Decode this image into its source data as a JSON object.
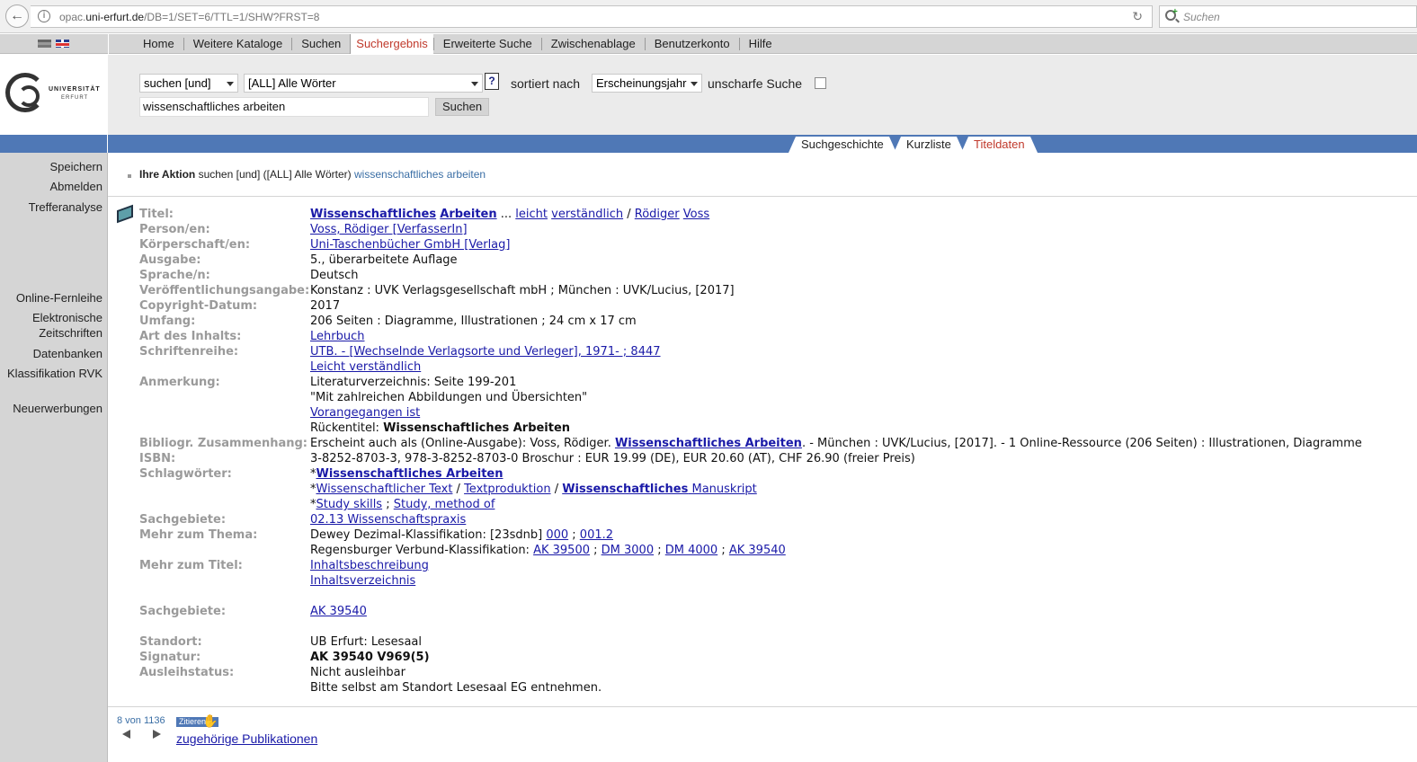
{
  "browser": {
    "url_prefix": "opac.",
    "url_domain": "uni-erfurt.de",
    "url_path": "/DB=1/SET=6/TTL=1/SHW?FRST=8",
    "search_placeholder": "Suchen"
  },
  "topnav": {
    "tabs": [
      "Home",
      "Weitere Kataloge",
      "Suchen",
      "Suchergebnis",
      "Erweiterte Suche",
      "Zwischenablage",
      "Benutzerkonto",
      "Hilfe"
    ],
    "active": "Suchergebnis"
  },
  "logo": {
    "line1": "UNIVERSITÄT",
    "line2": "ERFURT"
  },
  "search_form": {
    "mode": "suchen [und]",
    "field": "[ALL] Alle Wörter",
    "help": "?",
    "sort_label": "sortiert nach",
    "sort_value": "Erscheinungsjahr",
    "fuzzy_label": "unscharfe Suche",
    "query": "wissenschaftliches arbeiten",
    "submit": "Suchen"
  },
  "view_tabs": {
    "history": "Suchgeschichte",
    "short": "Kurzliste",
    "title": "Titeldaten"
  },
  "sidebar": {
    "save": "Speichern",
    "logout": "Abmelden",
    "analysis": "Trefferanalyse",
    "ill": "Online-Fernleihe",
    "ejournals1": "Elektronische",
    "ejournals2": "Zeitschriften",
    "databases": "Datenbanken",
    "rvk": "Klassifikation RVK",
    "new": "Neuerwerbungen"
  },
  "action": {
    "label": "Ihre Aktion",
    "text": "suchen [und] ([ALL] Alle Wörter)",
    "term": "wissenschaftliches arbeiten"
  },
  "record": {
    "labels": {
      "titel": "Titel:",
      "person": "Person/en:",
      "koerperschaft": "Körperschaft/en:",
      "ausgabe": "Ausgabe:",
      "sprache": "Sprache/n:",
      "veroeff": "Veröffentlichungsangabe:",
      "copyright": "Copyright-Datum:",
      "umfang": "Umfang:",
      "art": "Art des Inhalts:",
      "reihe": "Schriftenreihe:",
      "anmerkung": "Anmerkung:",
      "bibliogr": "Bibliogr. Zusammenhang:",
      "isbn": "ISBN:",
      "schlagwoerter": "Schlagwörter:",
      "sachgebiete": "Sachgebiete:",
      "thema": "Mehr zum Thema:",
      "mehrtitel": "Mehr zum Titel:",
      "sachgebiete2": "Sachgebiete:",
      "standort": "Standort:",
      "signatur": "Signatur:",
      "status": "Ausleihstatus:"
    },
    "title_w1": "Wissenschaftliches",
    "title_w2": "Arbeiten",
    "title_sep1": " ... ",
    "title_w3": "leicht",
    "title_w4": "verständlich",
    "title_sep2": " / ",
    "title_w5": "Rödiger",
    "title_w6": "Voss",
    "person": "Voss, Rödiger [VerfasserIn]",
    "koerperschaft": "Uni-Taschenbücher GmbH [Verlag]",
    "ausgabe": "5., überarbeitete Auflage",
    "sprache": "Deutsch",
    "veroeff": "Konstanz : UVK Verlagsgesellschaft mbH ; München : UVK/Lucius, [2017]",
    "copyright": "2017",
    "umfang": "206 Seiten : Diagramme, Illustrationen ; 24 cm x 17 cm",
    "art": "Lehrbuch",
    "reihe1": "UTB. - [Wechselnde Verlagsorte und Verleger], 1971- ; 8447",
    "reihe2": "Leicht verständlich",
    "anm1": "Literaturverzeichnis: Seite 199-201",
    "anm2": "\"Mit zahlreichen Abbildungen und Übersichten\"",
    "anm3": "Vorangegangen ist",
    "anm4_label": "Rückentitel: ",
    "anm4_value": "Wissenschaftliches Arbeiten",
    "bib_pre": "Erscheint auch als (Online-Ausgabe): Voss, Rödiger. ",
    "bib_link": "Wissenschaftliches Arbeiten",
    "bib_post": ". - München : UVK/Lucius, [2017]. - 1 Online-Ressource (206 Seiten) : Illustrationen, Diagramme",
    "isbn": "3-8252-8703-3, 978-3-8252-8703-0 Broschur : EUR 19.99 (DE), EUR 20.60 (AT), CHF 26.90 (freier Preis)",
    "sw_star": "*",
    "sw1": "Wissenschaftliches Arbeiten",
    "sw2a": "Wissenschaftlicher Text",
    "sw2b": "Textproduktion",
    "sw2c_bold": "Wissenschaftliches",
    "sw2c_rest": "Manuskript",
    "sw3a": "Study skills",
    "sw3b": "Study, method of",
    "sep_slash": " / ",
    "sep_semi": " ; ",
    "sachgebiete": "02.13 Wissenschaftspraxis",
    "dewey_label": "Dewey Dezimal-Klassifikation: [23sdnb] ",
    "dewey1": "000",
    "dewey2": "001.2",
    "rvk_label": "Regensburger Verbund-Klassifikation: ",
    "rvk1": "AK 39500",
    "rvk2": "DM 3000",
    "rvk3": "DM 4000",
    "rvk4": "AK 39540",
    "mehr1": "Inhaltsbeschreibung",
    "mehr2": "Inhaltsverzeichnis",
    "sachgebiete2": "AK 39540",
    "standort": "UB Erfurt: Lesesaal",
    "signatur": "AK 39540 V969(5)",
    "status1": "Nicht ausleihbar",
    "status2": "Bitte selbst am Standort Lesesaal EG entnehmen."
  },
  "pager": {
    "count": "8 von 1136",
    "cite": "Zitieren",
    "related": "zugehörige Publikationen"
  }
}
